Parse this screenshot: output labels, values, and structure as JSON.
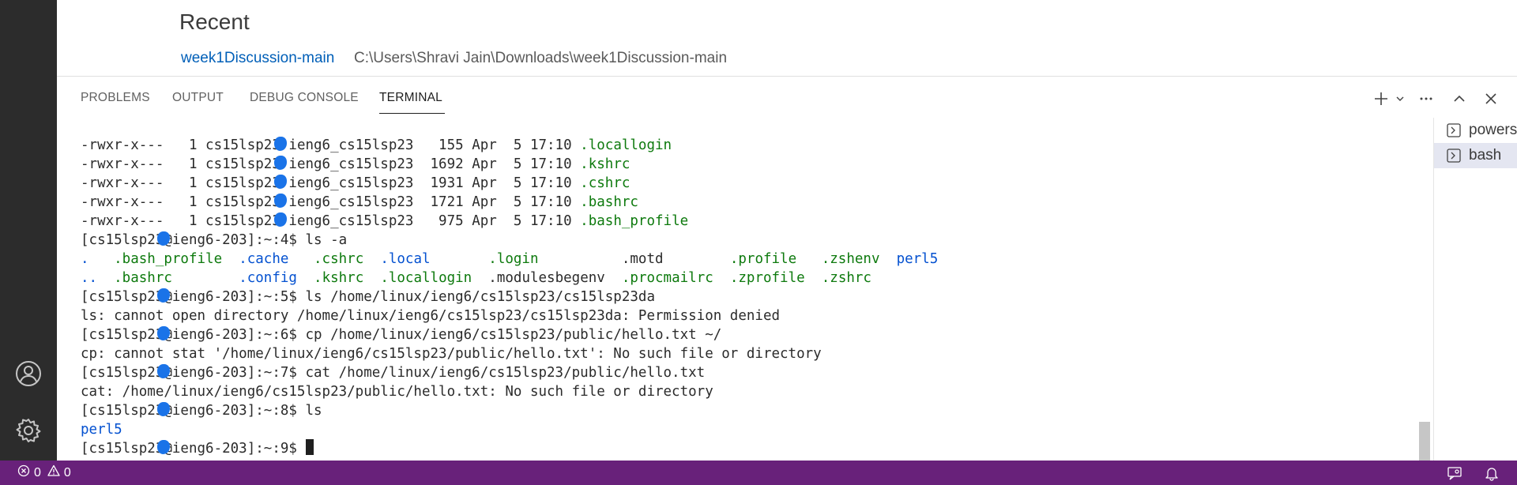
{
  "welcome": {
    "heading": "Recent",
    "recent_items": [
      {
        "name": "week1Discussion-main",
        "path": "C:\\Users\\Shravi Jain\\Downloads\\week1Discussion-main"
      }
    ]
  },
  "panel": {
    "tabs": [
      {
        "label": "PROBLEMS"
      },
      {
        "label": "OUTPUT"
      },
      {
        "label": "DEBUG CONSOLE"
      },
      {
        "label": "TERMINAL"
      }
    ],
    "active_tab": "TERMINAL",
    "actions": [
      "new-terminal-icon",
      "chevron-down-icon",
      "more-actions-icon",
      "maximize-panel-icon",
      "close-panel-icon"
    ]
  },
  "terminal": {
    "lines": [
      {
        "segments": [
          {
            "text": "-rwxr-x---   1 cs15lsp23",
            "color": "default"
          },
          {
            "redacted": true
          },
          {
            "text": " ieng6_cs15lsp23   155 Apr  5 17:10 ",
            "color": "default"
          },
          {
            "text": ".locallogin",
            "color": "green"
          }
        ]
      },
      {
        "segments": [
          {
            "text": "-rwxr-x---   1 cs15lsp23",
            "color": "default"
          },
          {
            "redacted": true
          },
          {
            "text": " ieng6_cs15lsp23  1692 Apr  5 17:10 ",
            "color": "default"
          },
          {
            "text": ".kshrc",
            "color": "green"
          }
        ]
      },
      {
        "segments": [
          {
            "text": "-rwxr-x---   1 cs15lsp23",
            "color": "default"
          },
          {
            "redacted": true
          },
          {
            "text": " ieng6_cs15lsp23  1931 Apr  5 17:10 ",
            "color": "default"
          },
          {
            "text": ".cshrc",
            "color": "green"
          }
        ]
      },
      {
        "segments": [
          {
            "text": "-rwxr-x---   1 cs15lsp23",
            "color": "default"
          },
          {
            "redacted": true
          },
          {
            "text": " ieng6_cs15lsp23  1721 Apr  5 17:10 ",
            "color": "default"
          },
          {
            "text": ".bashrc",
            "color": "green"
          }
        ]
      },
      {
        "segments": [
          {
            "text": "-rwxr-x---   1 cs15lsp23",
            "color": "default"
          },
          {
            "redacted": true
          },
          {
            "text": " ieng6_cs15lsp23   975 Apr  5 17:10 ",
            "color": "default"
          },
          {
            "text": ".bash_profile",
            "color": "green"
          }
        ]
      },
      {
        "segments": [
          {
            "text": "[cs15lsp23",
            "color": "default"
          },
          {
            "redacted": true
          },
          {
            "text": "@ieng6-203]:~:4$ ls -a",
            "color": "default"
          }
        ]
      },
      {
        "segments": [
          {
            "text": ".  ",
            "color": "blue"
          },
          {
            "text": " .bash_profile  ",
            "color": "green"
          },
          {
            "text": ".cache  ",
            "color": "blue"
          },
          {
            "text": " .cshrc  ",
            "color": "green"
          },
          {
            "text": ".local  ",
            "color": "blue"
          },
          {
            "text": "     .login  ",
            "color": "green"
          },
          {
            "text": "        .motd  ",
            "color": "dark"
          },
          {
            "text": "      .profile  ",
            "color": "green"
          },
          {
            "text": " .zshenv  ",
            "color": "green"
          },
          {
            "text": "perl5",
            "color": "blue"
          }
        ]
      },
      {
        "segments": [
          {
            "text": ".. ",
            "color": "blue"
          },
          {
            "text": " .bashrc   ",
            "color": "green"
          },
          {
            "text": "     .config  ",
            "color": "blue"
          },
          {
            "text": ".kshrc  ",
            "color": "green"
          },
          {
            "text": ".locallogin  ",
            "color": "green"
          },
          {
            "text": ".modulesbegenv  ",
            "color": "dark"
          },
          {
            "text": ".procmailrc  ",
            "color": "green"
          },
          {
            "text": ".zprofile  ",
            "color": "green"
          },
          {
            "text": ".zshrc",
            "color": "green"
          }
        ]
      },
      {
        "segments": [
          {
            "text": "[cs15lsp23",
            "color": "default"
          },
          {
            "redacted": true
          },
          {
            "text": "@ieng6-203]:~:5$ ls /home/linux/ieng6/cs15lsp23/cs15lsp23da",
            "color": "default"
          }
        ]
      },
      {
        "segments": [
          {
            "text": "ls: cannot open directory /home/linux/ieng6/cs15lsp23/cs15lsp23da: Permission denied",
            "color": "default"
          }
        ]
      },
      {
        "segments": [
          {
            "text": "[cs15lsp23",
            "color": "default"
          },
          {
            "redacted": true
          },
          {
            "text": "@ieng6-203]:~:6$ cp /home/linux/ieng6/cs15lsp23/public/hello.txt ~/",
            "color": "default"
          }
        ]
      },
      {
        "segments": [
          {
            "text": "cp: cannot stat '/home/linux/ieng6/cs15lsp23/public/hello.txt': No such file or directory",
            "color": "default"
          }
        ]
      },
      {
        "segments": [
          {
            "text": "[cs15lsp23",
            "color": "default"
          },
          {
            "redacted": true
          },
          {
            "text": "@ieng6-203]:~:7$ cat /home/linux/ieng6/cs15lsp23/public/hello.txt",
            "color": "default"
          }
        ]
      },
      {
        "segments": [
          {
            "text": "cat: /home/linux/ieng6/cs15lsp23/public/hello.txt: No such file or directory",
            "color": "default"
          }
        ]
      },
      {
        "segments": [
          {
            "text": "[cs15lsp23",
            "color": "default"
          },
          {
            "redacted": true
          },
          {
            "text": "@ieng6-203]:~:8$ ls",
            "color": "default"
          }
        ]
      },
      {
        "segments": [
          {
            "text": "perl5",
            "color": "blue"
          }
        ]
      },
      {
        "segments": [
          {
            "text": "[cs15lsp23",
            "color": "default"
          },
          {
            "redacted": true
          },
          {
            "text": "@ieng6-203]:~:9$ ",
            "color": "default"
          }
        ],
        "cursor": true
      }
    ]
  },
  "sessions": [
    {
      "label": "powershell",
      "icon": "terminal-icon",
      "selected": false
    },
    {
      "label": "bash",
      "icon": "terminal-icon",
      "selected": true
    }
  ],
  "status_bar": {
    "errors": "0",
    "warnings": "0",
    "right_icons": [
      "feedback-icon",
      "notifications-bell-icon"
    ]
  },
  "colors": {
    "activity_bar": "#2c2c2c",
    "status_bar": "#68217a",
    "link": "#005fb8",
    "term_green": "#0e7a0e",
    "term_blue": "#0451d0",
    "redaction_blue": "#1a73e8"
  }
}
